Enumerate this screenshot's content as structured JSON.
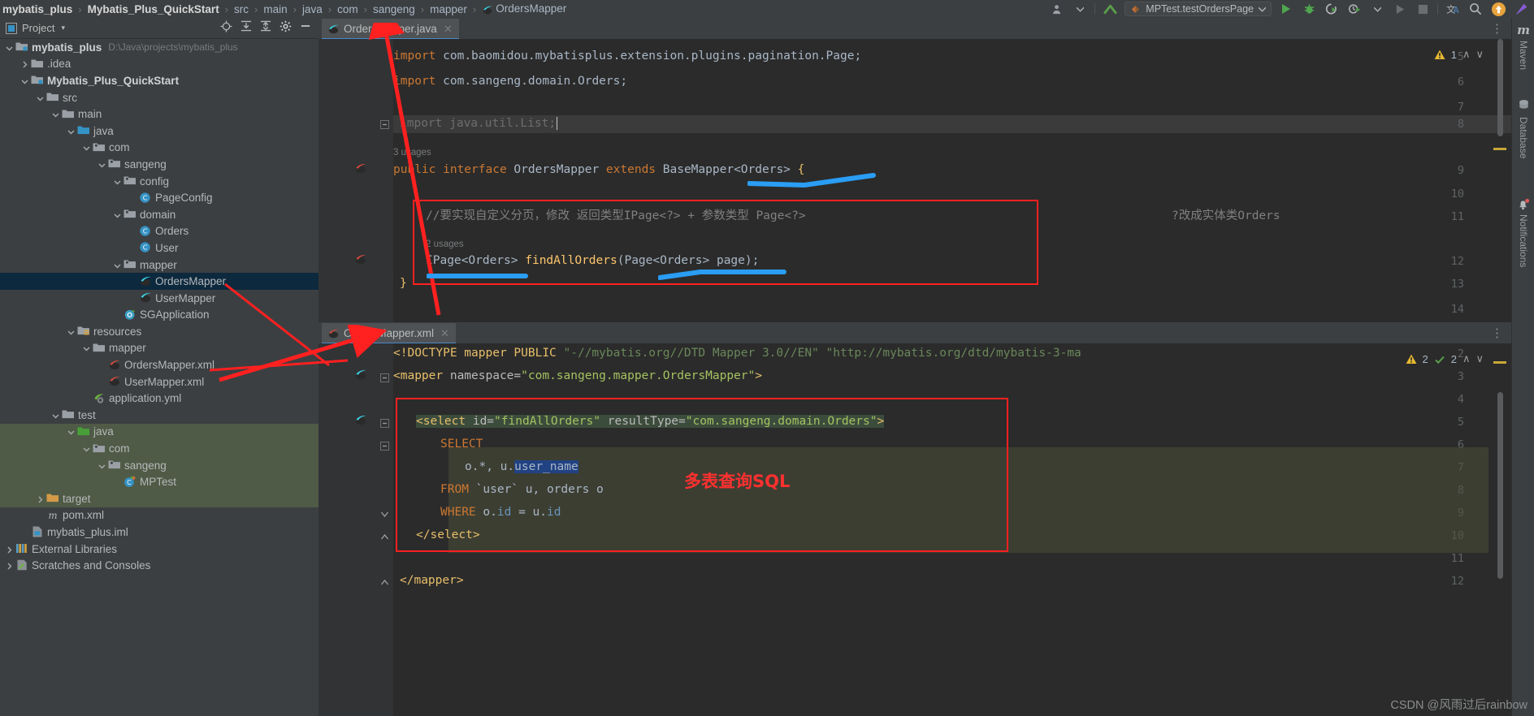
{
  "breadcrumb": {
    "items": [
      {
        "label": "mybatis_plus",
        "bold": true
      },
      {
        "label": "Mybatis_Plus_QuickStart",
        "bold": true
      },
      {
        "label": "src",
        "bold": false
      },
      {
        "label": "main",
        "bold": false
      },
      {
        "label": "java",
        "bold": false
      },
      {
        "label": "com",
        "bold": false
      },
      {
        "label": "sangeng",
        "bold": false
      },
      {
        "label": "mapper",
        "bold": false
      },
      {
        "label": "OrdersMapper",
        "bold": false,
        "icon": "java-interface-icon"
      }
    ],
    "separator": "›"
  },
  "toolbar": {
    "run_config": "MPTest.testOrdersPage",
    "icons": [
      "user-avatar-icon",
      "chevron-down-icon",
      "updates-arrow-icon",
      "run-icon",
      "debug-icon",
      "run-coverage-icon",
      "profiler-icon",
      "chevron-down-icon",
      "run-disabled-icon",
      "stop-icon",
      "translate-icon",
      "search-icon",
      "update-project-icon",
      "ide-assistant-icon"
    ]
  },
  "project_panel": {
    "title": "Project",
    "dropdown_caret": "▾",
    "actions": [
      "locate-icon",
      "expand-all-icon",
      "collapse-all-icon",
      "settings-gear-icon",
      "hide-panel-icon"
    ],
    "tree": [
      {
        "indent": 0,
        "arrow": "down",
        "icon": "module-folder-icon",
        "label": "mybatis_plus",
        "bold": true,
        "path": "D:\\Java\\projects\\mybatis_plus"
      },
      {
        "indent": 1,
        "arrow": "right",
        "icon": "folder-icon",
        "label": ".idea"
      },
      {
        "indent": 1,
        "arrow": "down",
        "icon": "module-folder-icon",
        "label": "Mybatis_Plus_QuickStart",
        "bold": true
      },
      {
        "indent": 2,
        "arrow": "down",
        "icon": "folder-icon",
        "label": "src"
      },
      {
        "indent": 3,
        "arrow": "down",
        "icon": "folder-icon",
        "label": "main"
      },
      {
        "indent": 4,
        "arrow": "down",
        "icon": "source-root-icon",
        "label": "java"
      },
      {
        "indent": 5,
        "arrow": "down",
        "icon": "package-icon",
        "label": "com"
      },
      {
        "indent": 6,
        "arrow": "down",
        "icon": "package-icon",
        "label": "sangeng"
      },
      {
        "indent": 7,
        "arrow": "down",
        "icon": "package-icon",
        "label": "config"
      },
      {
        "indent": 8,
        "arrow": "none",
        "icon": "java-class-icon",
        "label": "PageConfig"
      },
      {
        "indent": 7,
        "arrow": "down",
        "icon": "package-icon",
        "label": "domain"
      },
      {
        "indent": 8,
        "arrow": "none",
        "icon": "java-class-icon",
        "label": "Orders"
      },
      {
        "indent": 8,
        "arrow": "none",
        "icon": "java-class-icon",
        "label": "User"
      },
      {
        "indent": 7,
        "arrow": "down",
        "icon": "package-icon",
        "label": "mapper"
      },
      {
        "indent": 8,
        "arrow": "none",
        "icon": "mybatis-mapper-icon",
        "label": "OrdersMapper",
        "selected": true
      },
      {
        "indent": 8,
        "arrow": "none",
        "icon": "mybatis-mapper-icon",
        "label": "UserMapper"
      },
      {
        "indent": 7,
        "arrow": "none",
        "icon": "spring-boot-icon",
        "label": "SGApplication"
      },
      {
        "indent": 4,
        "arrow": "down",
        "icon": "resource-root-icon",
        "label": "resources"
      },
      {
        "indent": 5,
        "arrow": "down",
        "icon": "folder-icon",
        "label": "mapper"
      },
      {
        "indent": 6,
        "arrow": "none",
        "icon": "mybatis-xml-icon",
        "label": "OrdersMapper.xml"
      },
      {
        "indent": 6,
        "arrow": "none",
        "icon": "mybatis-xml-icon",
        "label": "UserMapper.xml"
      },
      {
        "indent": 5,
        "arrow": "none",
        "icon": "yml-spring-icon",
        "label": "application.yml"
      },
      {
        "indent": 3,
        "arrow": "down",
        "icon": "folder-icon",
        "label": "test"
      },
      {
        "indent": 4,
        "arrow": "down",
        "icon": "test-source-root-icon",
        "label": "java",
        "testbg": true
      },
      {
        "indent": 5,
        "arrow": "down",
        "icon": "package-icon",
        "label": "com",
        "testbg": true
      },
      {
        "indent": 6,
        "arrow": "down",
        "icon": "package-icon",
        "label": "sangeng",
        "testbg": true
      },
      {
        "indent": 7,
        "arrow": "none",
        "icon": "java-test-class-icon",
        "label": "MPTest",
        "testbg": true
      },
      {
        "indent": 2,
        "arrow": "right",
        "icon": "excluded-folder-icon",
        "label": "target",
        "testbg": true
      },
      {
        "indent": 2,
        "arrow": "none",
        "icon": "maven-pom-icon",
        "label": "pom.xml"
      },
      {
        "indent": 1,
        "arrow": "none",
        "icon": "iml-icon",
        "label": "mybatis_plus.iml"
      },
      {
        "indent": 0,
        "arrow": "right",
        "icon": "external-libraries-icon",
        "label": "External Libraries"
      },
      {
        "indent": 0,
        "arrow": "right",
        "icon": "scratches-icon",
        "label": "Scratches and Consoles"
      }
    ]
  },
  "java_editor": {
    "tab": {
      "label": "OrdersMapper.java",
      "icon": "mybatis-mapper-icon",
      "close": "✕"
    },
    "inspections": {
      "warning_icon": "warning-triangle-icon",
      "warning_count": "1",
      "up": "∧",
      "down": "∨"
    },
    "more_actions": "⋮",
    "lines": [
      {
        "num": "5",
        "text": "import com.baomidou.mybatisplus.extension.plugins.pagination.Page;"
      },
      {
        "num": "6",
        "text": "import com.sangeng.domain.Orders;"
      },
      {
        "num": "7",
        "text": ""
      },
      {
        "num": "8",
        "text": "import java.util.List;"
      },
      {
        "num": "9",
        "text": "public interface OrdersMapper extends BaseMapper<Orders> {"
      },
      {
        "num": "10",
        "text": ""
      },
      {
        "num": "11",
        "text": "//要实现自定义分页，修改 返回类型IPage<?> + 参数类型 Page<?>"
      },
      {
        "num": "12",
        "text": "IPage<Orders> findAllOrders(Page<Orders> page);"
      },
      {
        "num": "13",
        "text": "}"
      },
      {
        "num": "14",
        "text": ""
      }
    ],
    "usages_class": "3 usages",
    "usages_method": "2 usages",
    "comment_tail": "?改成实体类Orders"
  },
  "xml_editor": {
    "tab": {
      "label": "OrdersMapper.xml",
      "icon": "mybatis-xml-icon",
      "close": "✕"
    },
    "inspections": {
      "warning_icon": "warning-triangle-icon",
      "warning_count": "2",
      "weak_icon": "weak-warning-icon",
      "weak_count": "2",
      "up": "∧",
      "down": "∨"
    },
    "more_actions": "⋮",
    "lines": [
      {
        "num": "2",
        "text": "<!DOCTYPE mapper PUBLIC \"-//mybatis.org//DTD Mapper 3.0//EN\" \"http://mybatis.org/dtd/mybatis-3-ma"
      },
      {
        "num": "3",
        "text": "<mapper namespace=\"com.sangeng.mapper.OrdersMapper\">"
      },
      {
        "num": "4",
        "text": ""
      },
      {
        "num": "5",
        "text": "<select id=\"findAllOrders\" resultType=\"com.sangeng.domain.Orders\">"
      },
      {
        "num": "6",
        "text": "SELECT"
      },
      {
        "num": "7",
        "text": "o.*, u.user_name"
      },
      {
        "num": "8",
        "text": "FROM `user` u, orders o"
      },
      {
        "num": "9",
        "text": "WHERE o.id = u.id"
      },
      {
        "num": "10",
        "text": "</select>"
      },
      {
        "num": "11",
        "text": ""
      },
      {
        "num": "12",
        "text": "</mapper>"
      }
    ]
  },
  "annotations": {
    "sql_label": "多表查询SQL",
    "accent_red": "#ff2020",
    "accent_blue": "#2a9df4"
  },
  "right_tools": [
    {
      "label": "Maven",
      "icon": "maven-icon"
    },
    {
      "label": "Database",
      "icon": "database-icon"
    },
    {
      "label": "Notifications",
      "icon": "notifications-bell-icon"
    }
  ],
  "watermark": "CSDN @风雨过后rainbow"
}
